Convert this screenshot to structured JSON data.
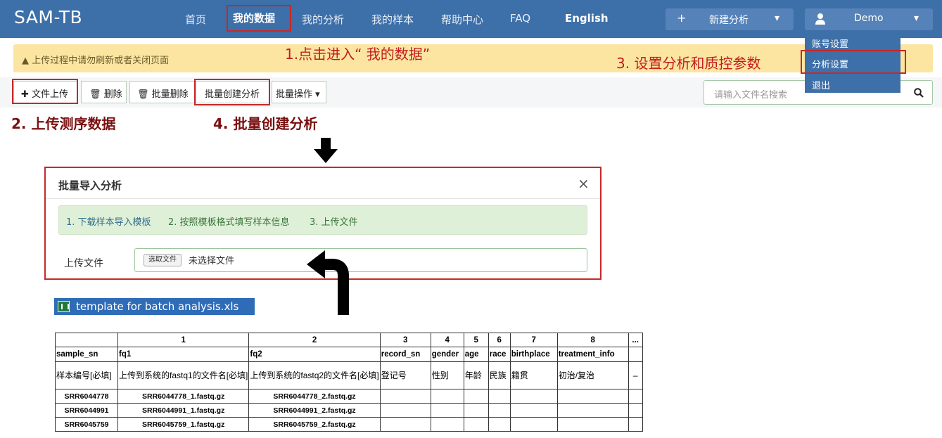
{
  "navbar": {
    "brand": "SAM-TB",
    "items": [
      "首页",
      "我的数据",
      "我的分析",
      "我的样本",
      "帮助中心",
      "FAQ",
      "English"
    ],
    "new_analysis": {
      "plus": "+",
      "label": "新建分析",
      "caret": "▾"
    },
    "user": {
      "name": "Demo",
      "caret": "▾"
    },
    "accent_color": "#3d6fa8"
  },
  "dropdown": {
    "items": [
      "账号设置",
      "分析设置",
      "退出"
    ]
  },
  "warning": {
    "icon": "▲",
    "text": "上传过程中请勿刷新或者关闭页面"
  },
  "toolbar": {
    "upload": "✚ 文件上传",
    "delete": "🗑 删除",
    "batch_delete": "🗑 批量删除",
    "batch_create": "批量创建分析",
    "batch_ops": "批量操作 ▾"
  },
  "search": {
    "placeholder": "请输入文件名搜索",
    "icon": "⚲"
  },
  "annotations": {
    "step1": "1.点击进入“ 我的数据”",
    "step2": "2. 上传测序数据",
    "step3": "3. 设置分析和质控参数",
    "step4": "4. 批量创建分析"
  },
  "modal": {
    "title": "批量导入分析",
    "close": "×",
    "steps": [
      "1. 下载样本导入模板",
      "2. 按照模板格式填写样本信息",
      "3. 上传文件"
    ],
    "upload_label": "上传文件",
    "file_button": "选取文件",
    "no_file": "未选择文件"
  },
  "file_tag": {
    "icon": "excel-icon",
    "name": "template for batch analysis.xls"
  },
  "sheet": {
    "col_numbers": [
      "",
      "1",
      "2",
      "3",
      "4",
      "5",
      "6",
      "7",
      "8",
      "..."
    ],
    "fields": [
      "sample_sn",
      "fq1",
      "fq2",
      "record_sn",
      "gender",
      "age",
      "race",
      "birthplace",
      "treatment_info",
      ""
    ],
    "descriptions": [
      "样本编号[必填]",
      "上传到系统的fastq1的文件名[必填]",
      "上传到系统的fastq2的文件名[必填]",
      "登记号",
      "性别",
      "年龄",
      "民族",
      "籍贯",
      "初治/复治",
      "–"
    ],
    "rows": [
      [
        "SRR6044778",
        "SRR6044778_1.fastq.gz",
        "SRR6044778_2.fastq.gz",
        "",
        "",
        "",
        "",
        "",
        "",
        ""
      ],
      [
        "SRR6044991",
        "SRR6044991_1.fastq.gz",
        "SRR6044991_2.fastq.gz",
        "",
        "",
        "",
        "",
        "",
        "",
        ""
      ],
      [
        "SRR6045759",
        "SRR6045759_1.fastq.gz",
        "SRR6045759_2.fastq.gz",
        "",
        "",
        "",
        "",
        "",
        "",
        ""
      ]
    ]
  }
}
